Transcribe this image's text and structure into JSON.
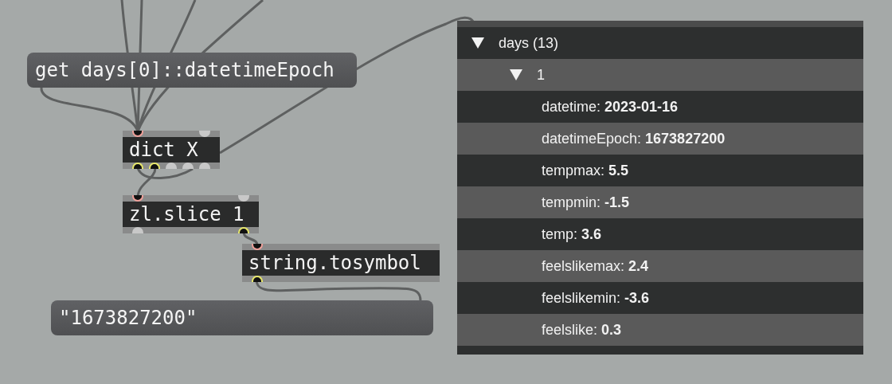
{
  "patcher": {
    "nodes": [
      {
        "kind": "message",
        "text": "get days[0]::datetimeEpoch"
      },
      {
        "kind": "object",
        "text": "dict X",
        "inlets": [
          {
            "connected": true
          },
          {
            "connected": false
          }
        ],
        "outlets": [
          {
            "connected": true
          },
          {
            "connected": true
          },
          {
            "connected": false
          },
          {
            "connected": false
          },
          {
            "connected": false
          }
        ]
      },
      {
        "kind": "object",
        "text": "zl.slice 1",
        "inlets": [
          {
            "connected": true
          },
          {
            "connected": false
          }
        ],
        "outlets": [
          {
            "connected": false
          },
          {
            "connected": true
          }
        ]
      },
      {
        "kind": "object",
        "text": "string.tosymbol",
        "inlets": [
          {
            "connected": true
          }
        ],
        "outlets": [
          {
            "connected": true
          }
        ]
      },
      {
        "kind": "message",
        "text": "\"1673827200\""
      }
    ]
  },
  "dict_view": {
    "tree": [
      {
        "label": "days (13)",
        "expanded": true,
        "children": [
          {
            "label": "1",
            "expanded": true,
            "children": [
              {
                "label": "datetime: **2023-01-16**"
              },
              {
                "label": "datetimeEpoch: **1673827200**"
              },
              {
                "label": "tempmax: **5.5**"
              },
              {
                "label": "tempmin: **-1.5**"
              },
              {
                "label": "temp: **3.6**"
              },
              {
                "label": "feelslikemax: **2.4**"
              },
              {
                "label": "feelslikemin: **-3.6**"
              },
              {
                "label": "feelslike: **0.3**"
              }
            ]
          }
        ]
      }
    ]
  }
}
